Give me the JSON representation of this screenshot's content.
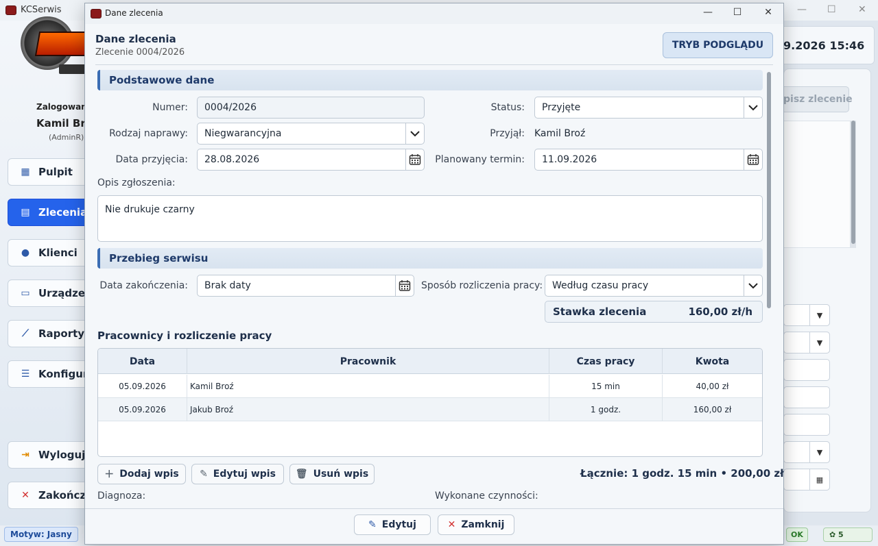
{
  "app": {
    "title": "KCSerwis",
    "datetime": "9.2026 15:46",
    "theme_label": "Motyw: Jasny",
    "status_ok": "OK",
    "status_count": "5",
    "bg_opis_button": "pisz zlecenie"
  },
  "sidebar": {
    "logged_label": "Zalogowan",
    "user_name": "Kamil Broź",
    "user_role": "(AdminR)",
    "items": [
      {
        "label": "Pulpit",
        "icon": "dashboard-icon"
      },
      {
        "label": "Zlecenia",
        "icon": "document-icon"
      },
      {
        "label": "Klienci",
        "icon": "users-icon"
      },
      {
        "label": "Urządzen",
        "icon": "monitor-icon"
      },
      {
        "label": "Raporty",
        "icon": "chart-icon"
      },
      {
        "label": "Konfigura",
        "icon": "settings-sliders-icon"
      },
      {
        "label": "Wyloguj",
        "icon": "logout-icon"
      },
      {
        "label": "Zakończ",
        "icon": "close-icon"
      }
    ]
  },
  "dialog": {
    "window_title": "Dane zlecenia",
    "header_title": "Dane zlecenia",
    "header_subtitle": "Zlecenie 0004/2026",
    "mode_button": "TRYB PODGLĄDU",
    "section_basic": "Podstawowe dane",
    "fields": {
      "numer_label": "Numer:",
      "numer_value": "0004/2026",
      "status_label": "Status:",
      "status_value": "Przyjęte",
      "rodzaj_label": "Rodzaj naprawy:",
      "rodzaj_value": "Niegwarancyjna",
      "przyjal_label": "Przyjął:",
      "przyjal_value": "Kamil Broź",
      "data_przyjecia_label": "Data przyjęcia:",
      "data_przyjecia_value": "28.08.2026",
      "planowany_label": "Planowany termin:",
      "planowany_value": "11.09.2026",
      "opis_label": "Opis zgłoszenia:",
      "opis_value": "Nie drukuje czarny"
    },
    "section_service": "Przebieg serwisu",
    "service": {
      "data_zak_label": "Data zakończenia:",
      "data_zak_value": "Brak daty",
      "sposob_label": "Sposób rozliczenia pracy:",
      "sposob_value": "Według czasu pracy",
      "stawka_label": "Stawka zlecenia",
      "stawka_value": "160,00 zł/h"
    },
    "workers_title": "Pracownicy i rozliczenie pracy",
    "table": {
      "headers": [
        "Data",
        "Pracownik",
        "Czas pracy",
        "Kwota"
      ],
      "rows": [
        [
          "05.09.2026",
          "Kamil Broź",
          "15 min",
          "40,00 zł"
        ],
        [
          "05.09.2026",
          "Jakub Broź",
          "1 godz.",
          "160,00 zł"
        ]
      ]
    },
    "buttons": {
      "add": "Dodaj wpis",
      "edit": "Edytuj wpis",
      "delete": "Usuń wpis",
      "footer_edit": "Edytuj",
      "footer_close": "Zamknij"
    },
    "total": "Łącznie: 1 godz. 15 min • 200,00 zł",
    "diagnoza_label": "Diagnoza:",
    "wykonane_label": "Wykonane czynności:"
  }
}
